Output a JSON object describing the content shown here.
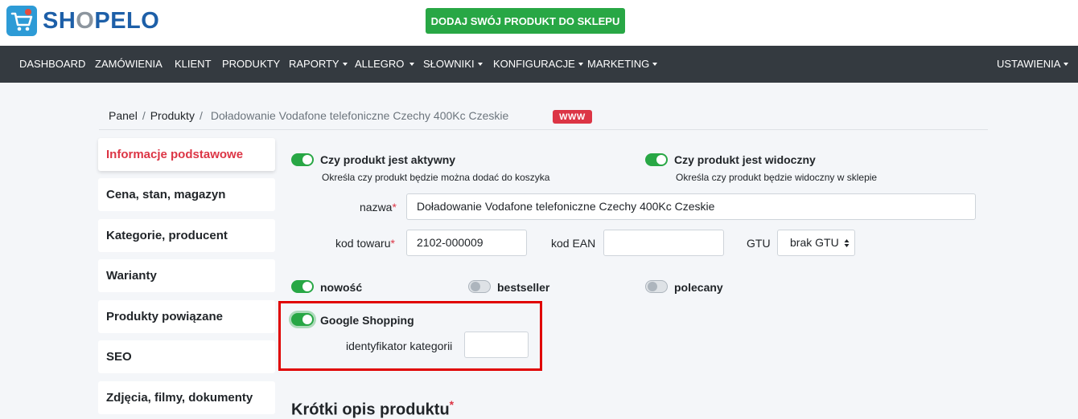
{
  "header": {
    "logo_text_pre": "SH",
    "logo_text_o": "O",
    "logo_text_post": "PELO",
    "add_product_label": "DODAJ SWÓJ PRODUKT DO SKLEPU"
  },
  "nav": {
    "items": [
      {
        "label": "DASHBOARD"
      },
      {
        "label": "ZAMÓWIENIA"
      },
      {
        "label": "KLIENT"
      },
      {
        "label": "PRODUKTY"
      },
      {
        "label": "RAPORTY"
      },
      {
        "label": "ALLEGRO"
      },
      {
        "label": "SŁOWNIKI"
      },
      {
        "label": "KONFIGURACJE"
      },
      {
        "label": "MARKETING"
      }
    ],
    "settings_label": "USTAWIENIA"
  },
  "breadcrumb": {
    "panel": "Panel",
    "products": "Produkty",
    "current": "Doładowanie Vodafone telefoniczne Czechy 400Kc Czeskie",
    "badge": "WWW"
  },
  "sidebar": {
    "items": [
      {
        "label": "Informacje podstawowe"
      },
      {
        "label": "Cena, stan, magazyn"
      },
      {
        "label": "Kategorie, producent"
      },
      {
        "label": "Warianty"
      },
      {
        "label": "Produkty powiązane"
      },
      {
        "label": "SEO"
      },
      {
        "label": "Zdjęcia, filmy, dokumenty"
      }
    ]
  },
  "form": {
    "active": {
      "label": "Czy produkt jest aktywny",
      "hint": "Określa czy produkt będzie można dodać do koszyka",
      "on": true
    },
    "visible": {
      "label": "Czy produkt jest widoczny",
      "hint": "Określa czy produkt będzie widoczny w sklepie",
      "on": true
    },
    "name_label": "nazwa",
    "name_value": "Doładowanie Vodafone telefoniczne Czechy 400Kc Czeskie",
    "code_label": "kod towaru",
    "code_value": "2102-000009",
    "ean_label": "kod EAN",
    "ean_value": "",
    "gtu_label": "GTU",
    "gtu_value": "brak GTU",
    "required_mark": "*",
    "flags": [
      {
        "label": "nowość",
        "on": true
      },
      {
        "label": "bestseller",
        "on": false
      },
      {
        "label": "polecany",
        "on": false
      }
    ],
    "google_shopping": {
      "label": "Google Shopping",
      "on": true,
      "category_label": "identyfikator kategorii",
      "category_value": ""
    },
    "short_description_title": "Krótki opis produktu"
  },
  "colors": {
    "accent_green": "#28a745",
    "nav_bg": "#343a40",
    "danger": "#dc3545",
    "brand_blue": "#1d5fa8",
    "highlight_red": "#e00000"
  }
}
